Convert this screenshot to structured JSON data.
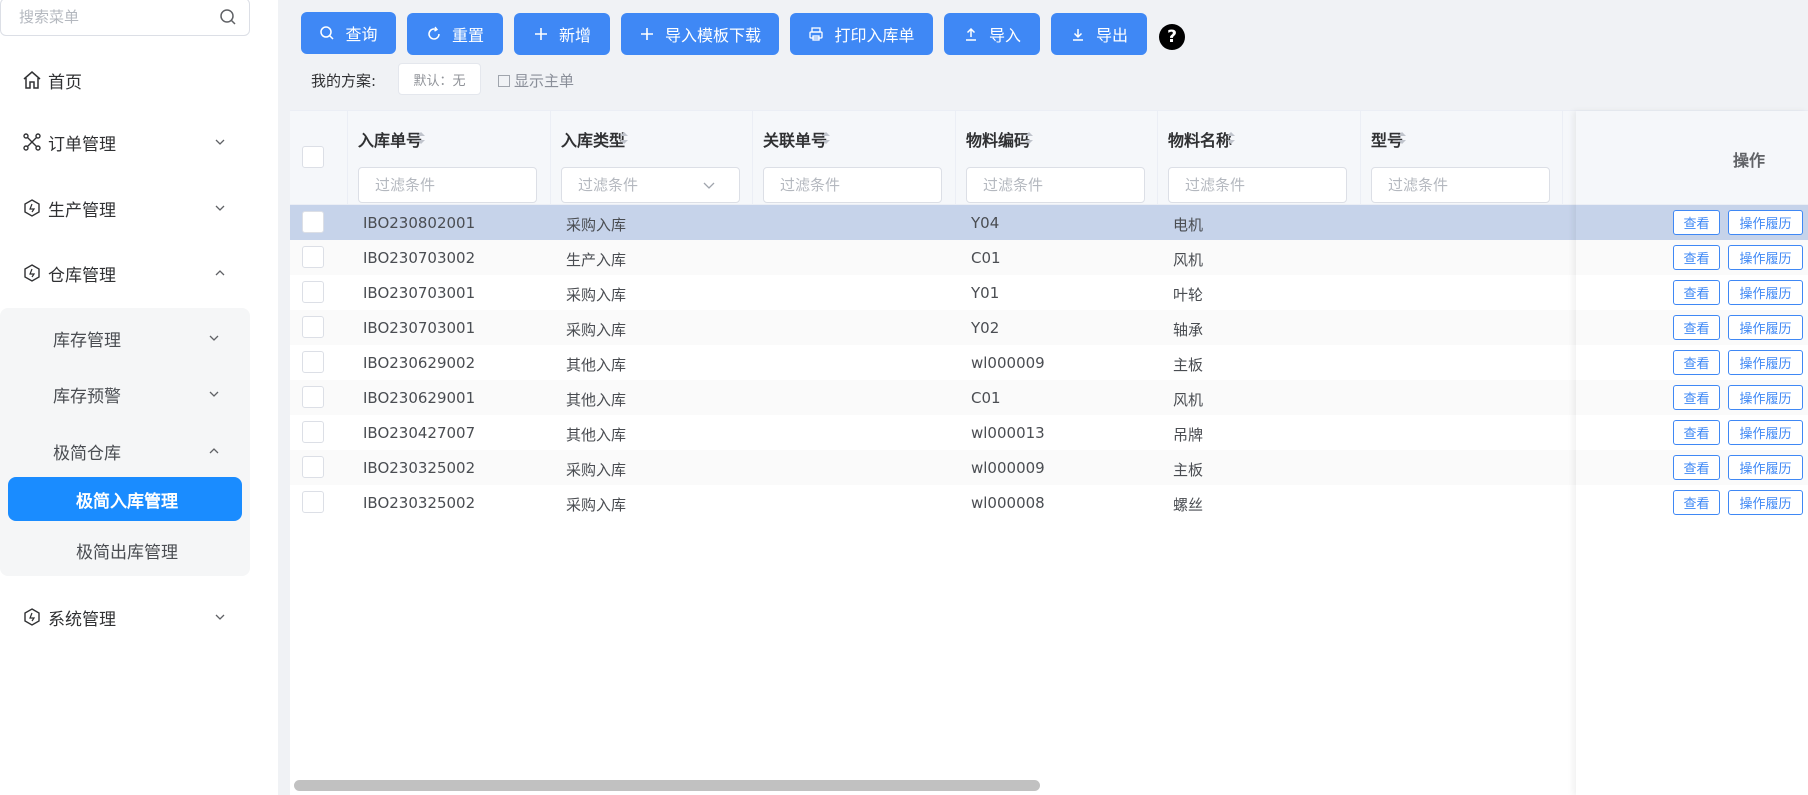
{
  "sidebar": {
    "search_placeholder": "搜索菜单",
    "menu": {
      "home": "首页",
      "orders": "订单管理",
      "production": "生产管理",
      "warehouse": "仓库管理",
      "inventory": "库存管理",
      "inventory_alert": "库存预警",
      "simple_warehouse": "极简仓库",
      "simple_inbound": "极简入库管理",
      "simple_outbound": "极简出库管理",
      "system": "系统管理"
    }
  },
  "toolbar": {
    "query": "查询",
    "reset": "重置",
    "add": "新增",
    "template": "导入模板下载",
    "print": "打印入库单",
    "import": "导入",
    "export": "导出",
    "help": "?"
  },
  "scheme": {
    "label": "我的方案:",
    "default_chip": "默认：无",
    "show_main": "显示主单"
  },
  "table": {
    "columns": [
      "入库单号",
      "入库类型",
      "关联单号",
      "物料编码",
      "物料名称",
      "型号"
    ],
    "filter_placeholder": "过滤条件",
    "ops_header": "操作",
    "view_label": "查看",
    "history_label": "操作履历",
    "rows": [
      {
        "no": "IBO230802001",
        "type": "采购入库",
        "code": "Y04",
        "name": "电机"
      },
      {
        "no": "IBO230703002",
        "type": "生产入库",
        "code": "C01",
        "name": "风机"
      },
      {
        "no": "IBO230703001",
        "type": "采购入库",
        "code": "Y01",
        "name": "叶轮"
      },
      {
        "no": "IBO230703001",
        "type": "采购入库",
        "code": "Y02",
        "name": "轴承"
      },
      {
        "no": "IBO230629002",
        "type": "其他入库",
        "code": "wl000009",
        "name": "主板"
      },
      {
        "no": "IBO230629001",
        "type": "其他入库",
        "code": "C01",
        "name": "风机"
      },
      {
        "no": "IBO230427007",
        "type": "其他入库",
        "code": "wl000013",
        "name": "吊牌"
      },
      {
        "no": "IBO230325002",
        "type": "采购入库",
        "code": "wl000009",
        "name": "主板"
      },
      {
        "no": "IBO230325002",
        "type": "采购入库",
        "code": "wl000008",
        "name": "螺丝"
      }
    ]
  },
  "colors": {
    "primary": "#3f88f5",
    "active_menu": "#1a8cff",
    "selected_row": "#c6d3ea"
  }
}
